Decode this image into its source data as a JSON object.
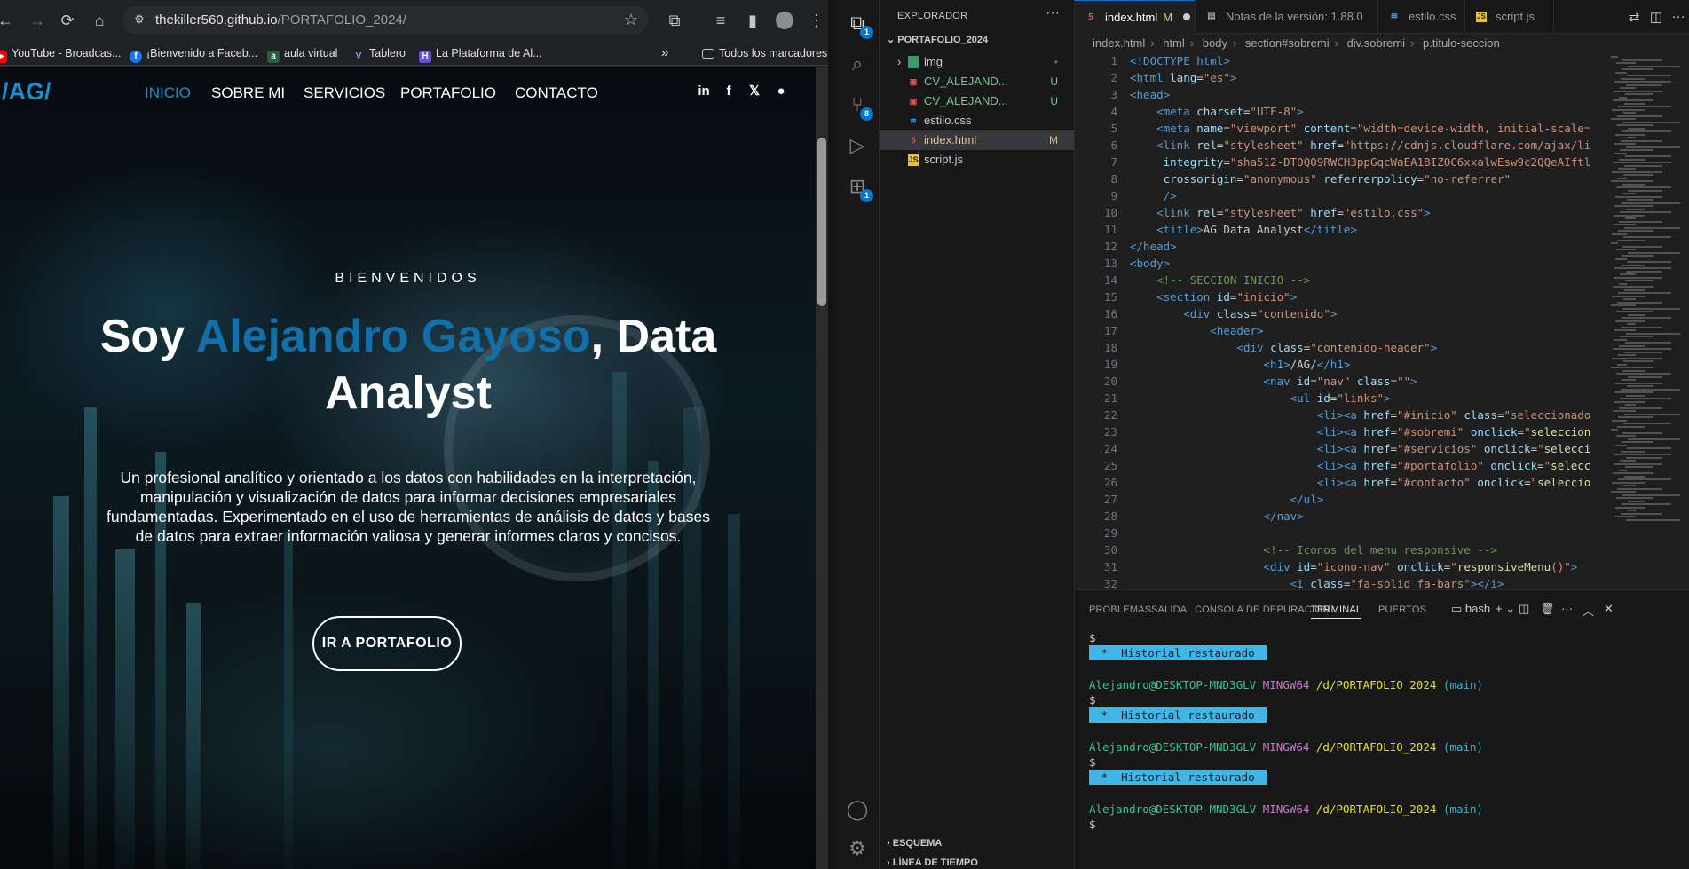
{
  "browser": {
    "url_host": "thekiller560.github.io",
    "url_path": "/PORTAFOLIO_2024/",
    "bookmarks": [
      {
        "label": "YouTube - Broadcas...",
        "icon": "youtube-icon"
      },
      {
        "label": "¡Bienvenido a Faceb...",
        "icon": "facebook-icon"
      },
      {
        "label": "aula virtual",
        "icon": "aula-icon"
      },
      {
        "label": "Tablero",
        "icon": "tablero-icon"
      },
      {
        "label": "La Plataforma de Al...",
        "icon": "platform-icon"
      }
    ],
    "more_bookmarks": "»",
    "all_bookmarks": "Todos los marcadores"
  },
  "site": {
    "logo": "/AG/",
    "nav": [
      "INICIO",
      "SOBRE MI",
      "SERVICIOS",
      "PORTAFOLIO",
      "CONTACTO"
    ],
    "social_icons": [
      "linkedin-icon",
      "facebook-icon",
      "x-icon",
      "github-icon"
    ],
    "welcome": "BIENVENIDOS",
    "headline_pre": "Soy ",
    "headline_name": "Alejandro Gayoso",
    "headline_post": ", Data Analyst",
    "intro": "Un profesional analítico y orientado a los datos con habilidades en la interpretación, manipulación y visualización de datos para informar decisiones empresariales fundamentadas. Experimentado en el uso de herramientas de análisis de datos y bases de datos para extraer información valiosa y generar informes claros y concisos.",
    "cta": "IR A PORTAFOLIO"
  },
  "vscode": {
    "explorer_title": "EXPLORADOR",
    "project": "PORTAFOLIO_2024",
    "files": [
      {
        "name": "img",
        "status": "•",
        "icon": "folder-icon"
      },
      {
        "name": "CV_ALEJAND...",
        "status": "U",
        "icon": "pdf-icon"
      },
      {
        "name": "CV_ALEJAND...",
        "status": "U",
        "icon": "pdf-icon"
      },
      {
        "name": "estilo.css",
        "status": "",
        "icon": "css-icon"
      },
      {
        "name": "index.html",
        "status": "M",
        "icon": "html-icon"
      },
      {
        "name": "script.js",
        "status": "",
        "icon": "js-icon"
      }
    ],
    "outline": "ESQUEMA",
    "timeline": "LÍNEA DE TIEMPO",
    "tabs": [
      {
        "label": "index.html",
        "mod": "M",
        "icon": "html-icon"
      },
      {
        "label": "Notas de la versión: 1.88.0",
        "icon": "doc-icon"
      },
      {
        "label": "estilo.css",
        "icon": "css-icon"
      },
      {
        "label": "script.js",
        "icon": "js-icon"
      }
    ],
    "breadcrumbs": [
      "index.html",
      "html",
      "body",
      "section#sobremi",
      "div.sobremi",
      "p.titulo-seccion"
    ],
    "badges": {
      "explorer": "1",
      "scm": "8",
      "extensions": "1"
    },
    "panel_tabs": [
      "PROBLEMAS",
      "SALIDA",
      "CONSOLA DE DEPURACIÓN",
      "TERMINAL",
      "PUERTOS"
    ],
    "shell": "bash",
    "terminal": {
      "prompt_user": "Alejandro@DESKTOP-MND3GLV",
      "prompt_env": "MINGW64",
      "prompt_dir": "/d/PORTAFOLIO_2024",
      "prompt_branch": "(main)",
      "dollar": "$",
      "restored": " *  Historial restaurado "
    }
  }
}
